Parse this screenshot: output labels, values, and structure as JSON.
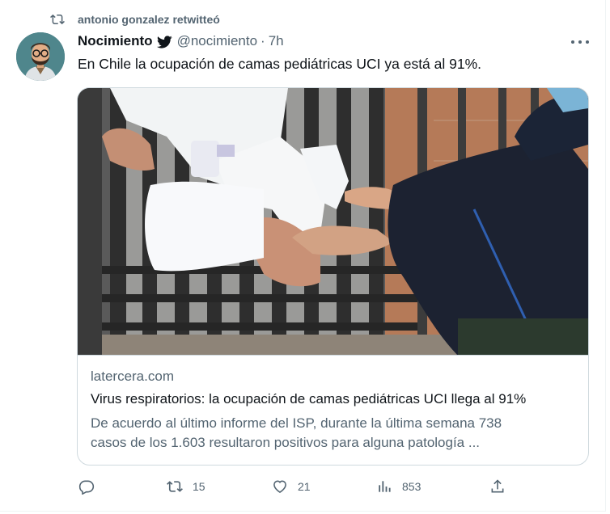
{
  "retweet": {
    "icon": "retweet-icon",
    "text": "antonio gonzalez retwitteó"
  },
  "tweet": {
    "author": {
      "display_name": "Nocimiento",
      "handle": "@nocimiento",
      "badge_icon": "twitter-bird-icon"
    },
    "separator": "·",
    "time": "7h",
    "text": "En Chile la ocupación de camas pediátricas UCI ya está al 91%.",
    "card": {
      "domain": "latercera.com",
      "title": "Virus respiratorios: la ocupación de camas pediátricas UCI llega al 91%",
      "description": "De acuerdo al último informe del ISP, durante la última semana 738\ncasos de los 1.603 resultaron positivos para alguna patología ..."
    },
    "actions": {
      "reply": {
        "icon": "reply-icon",
        "count": ""
      },
      "retweet": {
        "icon": "retweet-icon",
        "count": "15"
      },
      "like": {
        "icon": "heart-icon",
        "count": "21"
      },
      "views": {
        "icon": "views-icon",
        "count": "853"
      },
      "share": {
        "icon": "share-icon"
      }
    }
  },
  "colors": {
    "text": "#0f1419",
    "muted": "#536471",
    "border": "#cfd9de"
  }
}
